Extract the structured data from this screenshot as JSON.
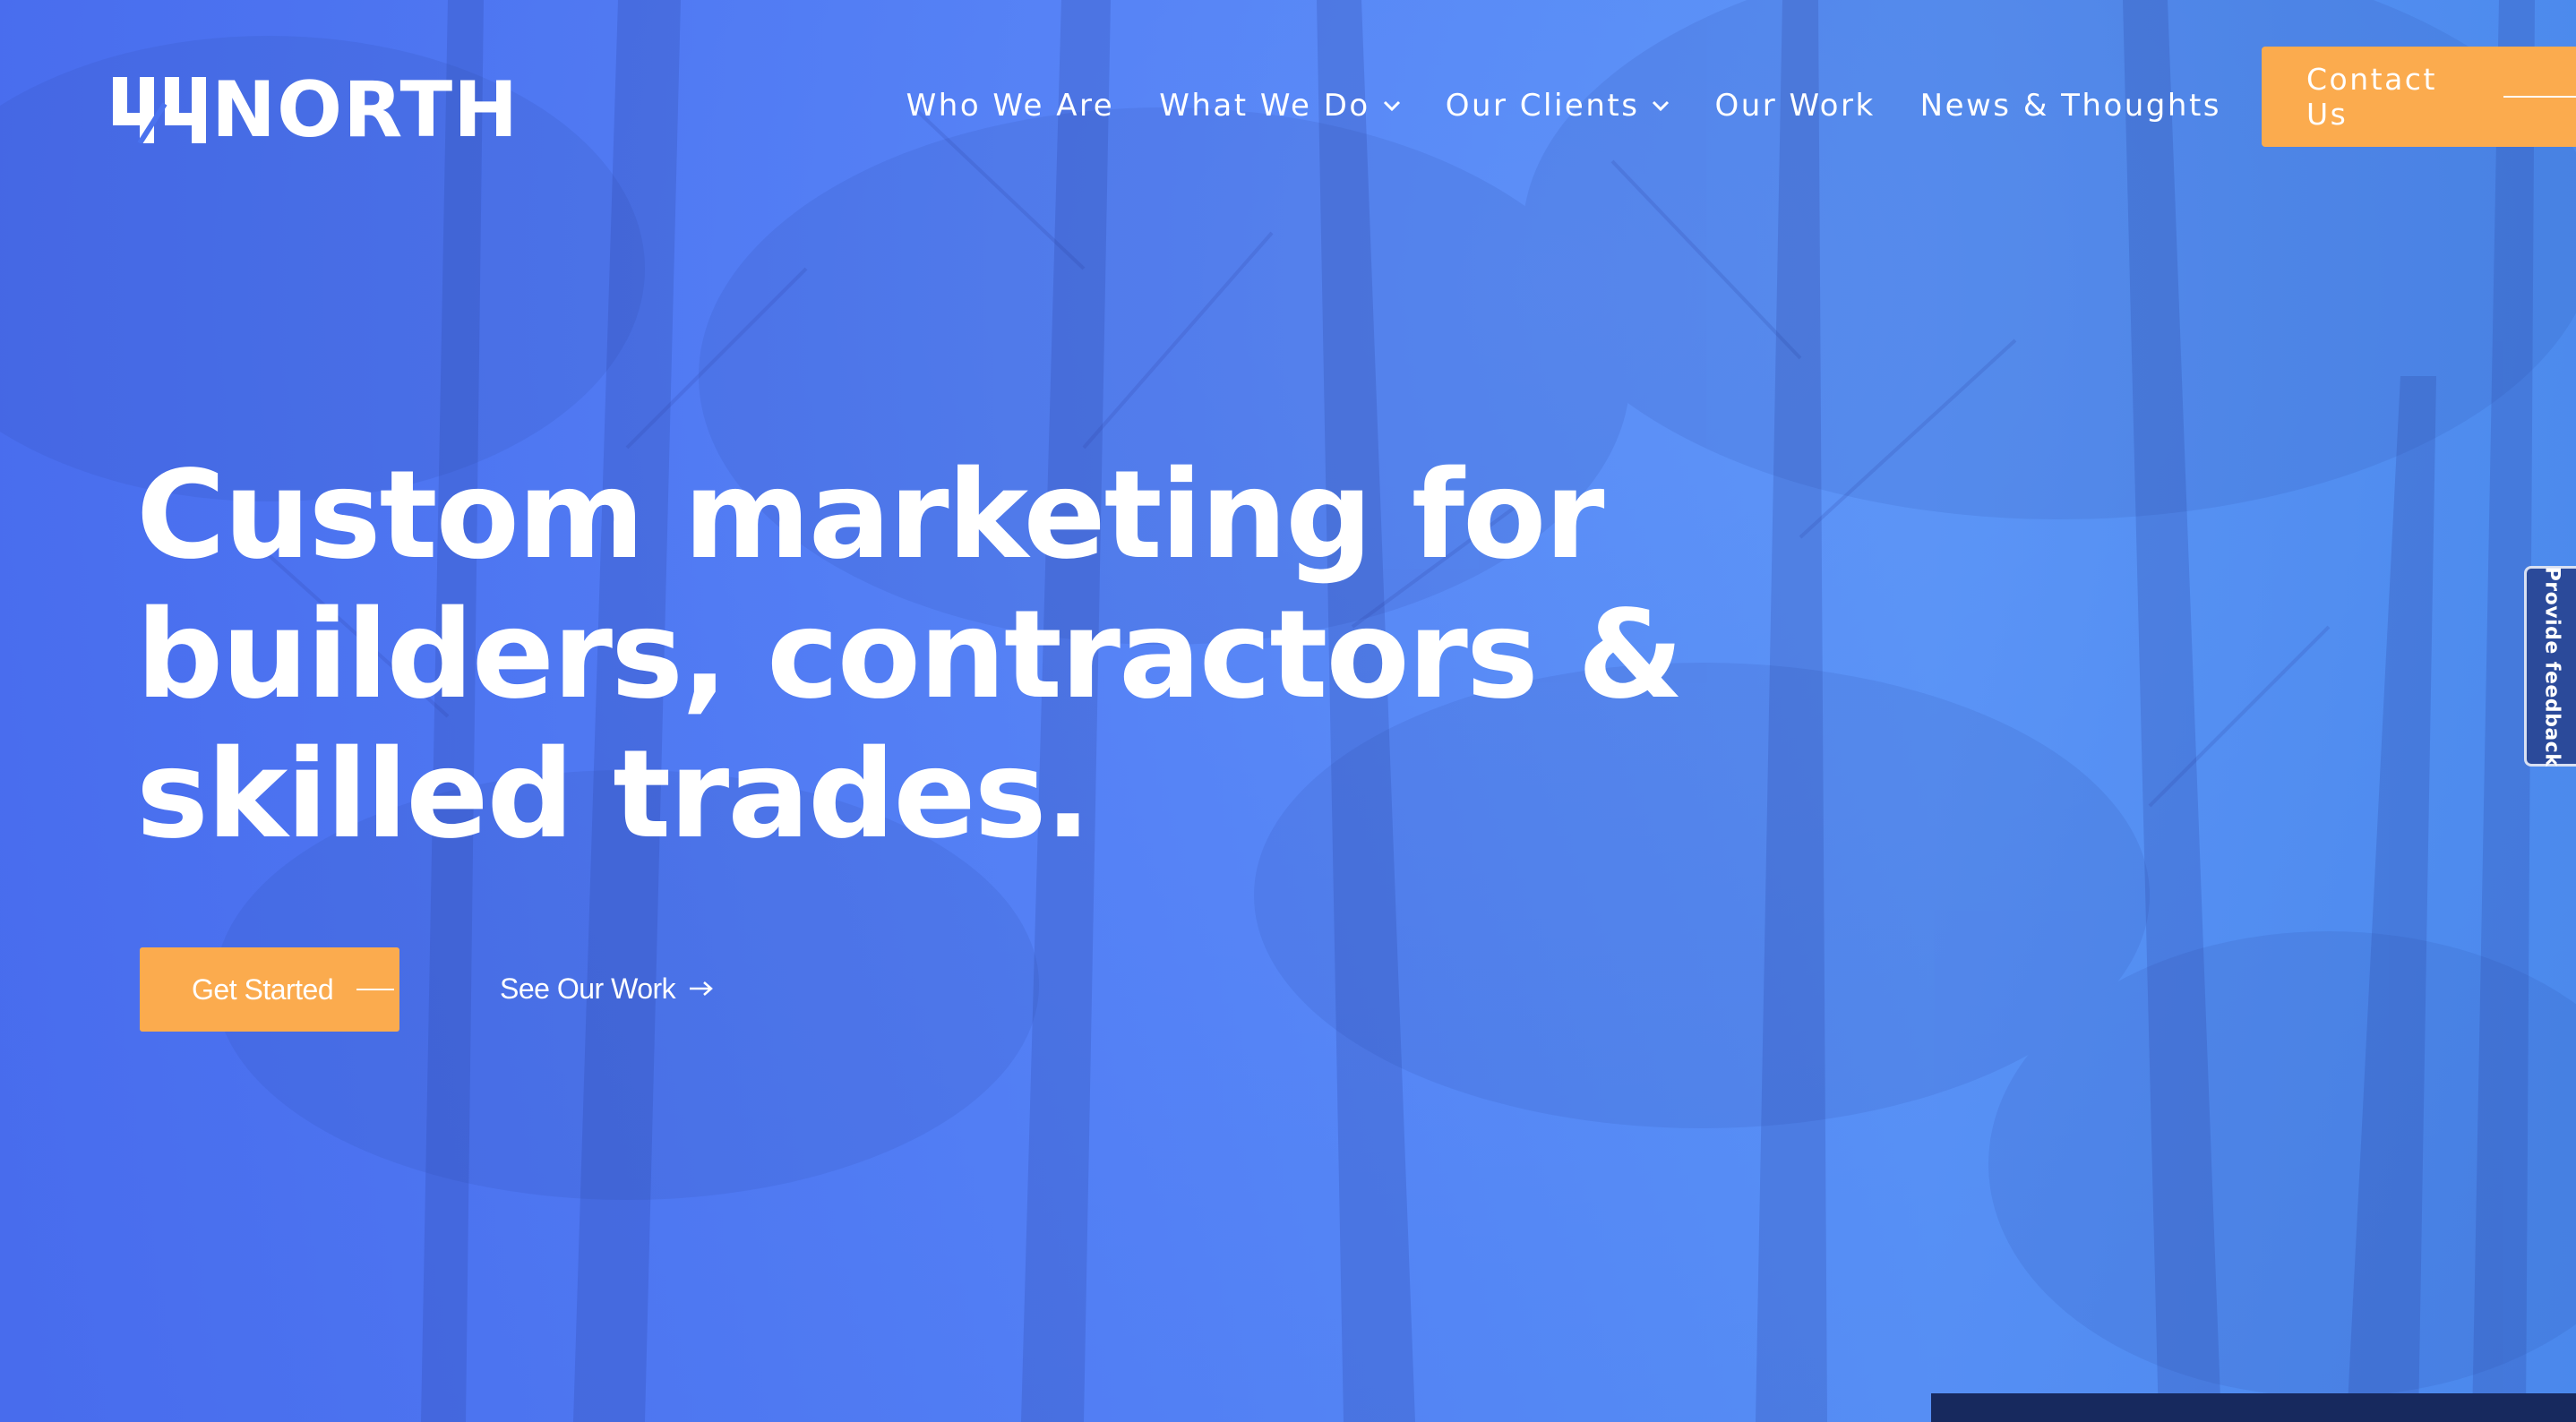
{
  "brand": {
    "logo_digits": "44",
    "logo_text": "NORTH"
  },
  "nav": {
    "items": [
      {
        "label": "Who We Are",
        "dropdown": false
      },
      {
        "label": "What We Do",
        "dropdown": true
      },
      {
        "label": "Our Clients",
        "dropdown": true
      },
      {
        "label": "Our Work",
        "dropdown": false
      },
      {
        "label": "News & Thoughts",
        "dropdown": false
      }
    ],
    "contact_label": "Contact Us"
  },
  "hero": {
    "headline_lines": [
      "Custom marketing for",
      "builders, contractors &",
      "skilled trades."
    ],
    "primary_cta": "Get Started",
    "secondary_cta": "See Our Work"
  },
  "feedback_tab": {
    "label": "Provide feedback"
  },
  "colors": {
    "overlay_blue": "#4a72ee",
    "accent_orange": "#fbab4e",
    "text_white": "#ffffff",
    "feedback_bg": "#2b4a9a",
    "bottom_strip": "#17295e"
  },
  "icons": {
    "dropdown": "chevron-down-icon",
    "secondary_cta": "arrow-right-icon"
  }
}
